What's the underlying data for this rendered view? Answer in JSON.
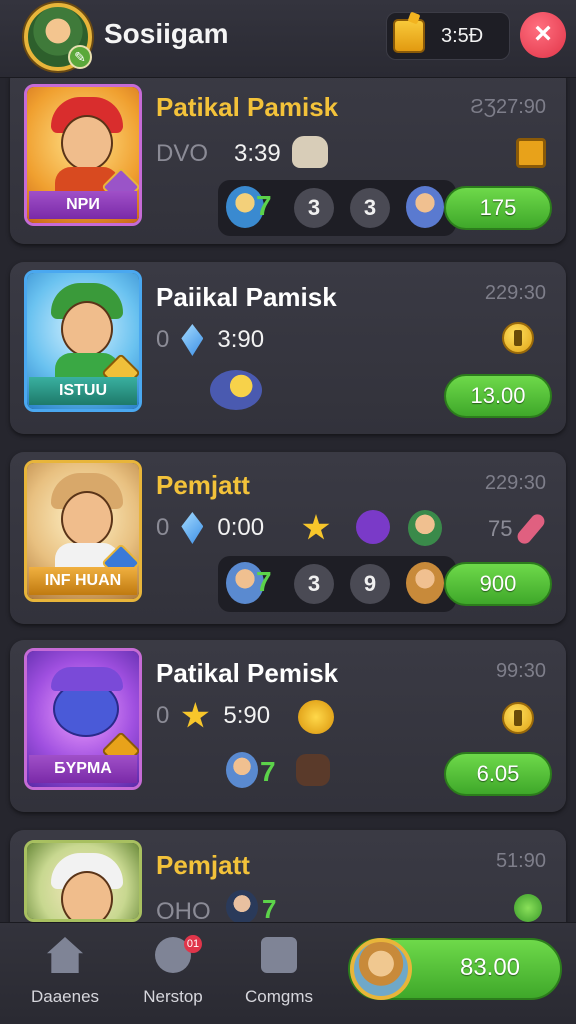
{
  "header": {
    "title": "Sosiigam",
    "timer": "3:5Ɖ"
  },
  "cards": [
    {
      "portrait_label": "NPИ",
      "title": "Patikal Pamisk",
      "title_color": "#f3c23a",
      "time": "ƧƷ27:90",
      "stat_prefix": "DVO",
      "stat_value": "3:39",
      "strip_num": "7",
      "circle_a": "3",
      "circle_b": "3",
      "button": "175"
    },
    {
      "portrait_label": "ISTUU",
      "title": "Paiikal Pamisk",
      "title_color": "#ffffff",
      "time": "229:30",
      "stat_prefix": "0",
      "stat_value": "3:90",
      "button": "13.00"
    },
    {
      "portrait_label": "INF HUAN",
      "title": "Pemjatt",
      "title_color": "#f3c23a",
      "time": "229:30",
      "stat_prefix": "0",
      "stat_value": "0:00",
      "side_value": "75",
      "strip_num": "7",
      "circle_a": "3",
      "circle_b": "9",
      "button": "900"
    },
    {
      "portrait_label": "БYPMA",
      "title": "Patikal Pemisk",
      "title_color": "#ffffff",
      "time": "99:30",
      "stat_prefix": "0",
      "stat_value": "5:90",
      "strip_num": "7",
      "button": "6.05"
    },
    {
      "portrait_label": "",
      "title": "Pemjatt",
      "title_color": "#f3c23a",
      "time": "51:90",
      "stat_prefix": "OHO",
      "strip_num": "7"
    }
  ],
  "nav": [
    {
      "label": "Daaenes",
      "icon": "home-icon"
    },
    {
      "label": "Nerstop",
      "icon": "gear-icon",
      "badge": "01"
    },
    {
      "label": "Comgms",
      "icon": "chat-icon"
    }
  ],
  "balance": "83.00"
}
